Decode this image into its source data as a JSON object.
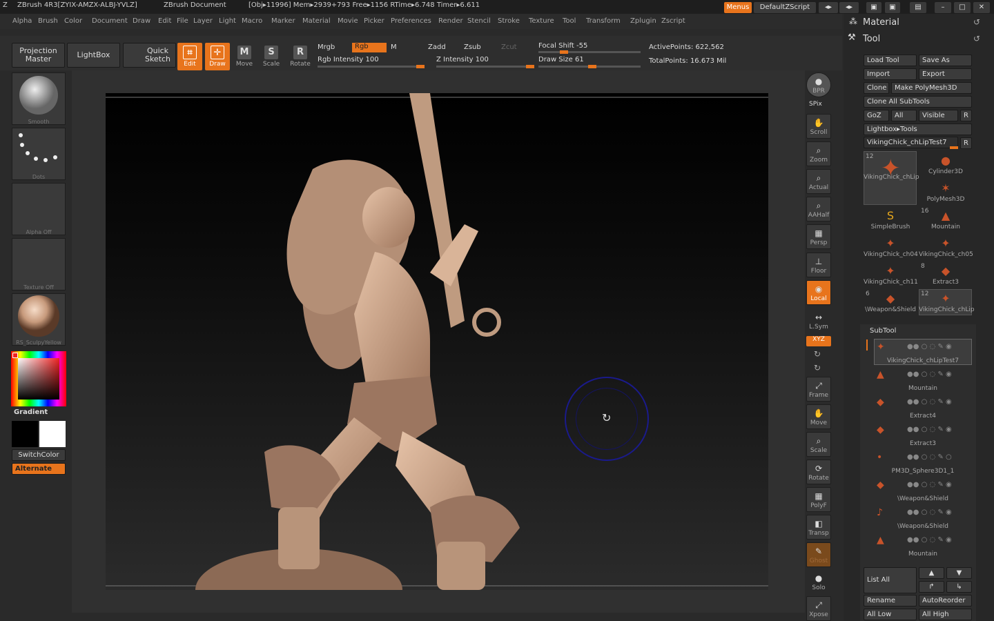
{
  "titlebar": {
    "app_title": "ZBrush 4R3[ZYIX-AMZX-ALBJ-YVLZ]",
    "document": "ZBrush Document",
    "stats": "[Obj▸11996] Mem▸2939+793 Free▸1156 RTime▸6.748 Timer▸6.611",
    "menus_label": "Menus",
    "script_label": "DefaultZScript"
  },
  "menubar": {
    "items": [
      "Alpha",
      "Brush",
      "Color",
      "Document",
      "Draw",
      "Edit",
      "File",
      "Layer",
      "Light",
      "Macro",
      "Marker",
      "Material",
      "Movie",
      "Picker",
      "Preferences",
      "Render",
      "Stencil",
      "Stroke",
      "Texture",
      "Tool",
      "Transform",
      "Zplugin",
      "Zscript"
    ]
  },
  "toolbar": {
    "projection_master": "Projection Master",
    "lightbox": "LightBox",
    "quick_sketch": "Quick Sketch",
    "edit": "Edit",
    "draw": "Draw",
    "move": "Move",
    "scale": "Scale",
    "rotate": "Rotate",
    "mrgb": "Mrgb",
    "rgb": "Rgb",
    "m": "M",
    "rgb_intensity": "Rgb Intensity 100",
    "zadd": "Zadd",
    "zsub": "Zsub",
    "zcut": "Zcut",
    "z_intensity": "Z Intensity 100",
    "focal_shift": "Focal Shift -55",
    "draw_size": "Draw Size 61",
    "active_points": "ActivePoints: 622,562",
    "total_points": "TotalPoints: 16.673 Mil",
    "rgb_intensity_value": 100,
    "z_intensity_value": 100,
    "focal_shift_value": -55,
    "draw_size_value": 61
  },
  "leftshelf": {
    "brush": "Smooth",
    "stroke": "Dots",
    "alpha": "Alpha  Off",
    "texture": "Texture  Off",
    "material": "RS_SculpyYellow",
    "gradient": "Gradient",
    "switch_color": "SwitchColor",
    "alternate": "Alternate"
  },
  "rightshelf": {
    "bpr": "BPR",
    "spix": "SPix",
    "scroll": "Scroll",
    "zoom": "Zoom",
    "actual": "Actual",
    "aahalf": "AAHalf",
    "persp": "Persp",
    "floor": "Floor",
    "local": "Local",
    "lsym": "L.Sym",
    "xyz": "XYZ",
    "frame": "Frame",
    "move": "Move",
    "scale": "Scale",
    "rotate": "Rotate",
    "polyf": "PolyF",
    "transp": "Transp",
    "ghost": "Ghost",
    "solo": "Solo",
    "xpose": "Xpose"
  },
  "palette": {
    "material": "Material",
    "tool": "Tool",
    "load_tool": "Load Tool",
    "save_as": "Save As",
    "import": "Import",
    "export": "Export",
    "clone": "Clone",
    "make_polymesh": "Make PolyMesh3D",
    "clone_all": "Clone  All  SubTools",
    "goz": "GoZ",
    "all": "All",
    "visible": "Visible",
    "r": "R",
    "lightbox_tools": "Lightbox▸Tools",
    "current_tool": "VikingChick_chLipTest7",
    "tools": [
      {
        "name": "VikingChick_chLip",
        "count": "12"
      },
      {
        "name": "Cylinder3D",
        "count": ""
      },
      {
        "name": "",
        "count": ""
      },
      {
        "name": "PolyMesh3D",
        "count": ""
      },
      {
        "name": "SimpleBrush",
        "count": ""
      },
      {
        "name": "Mountain",
        "count": "16"
      },
      {
        "name": "VikingChick_ch04",
        "count": ""
      },
      {
        "name": "VikingChick_ch05",
        "count": ""
      },
      {
        "name": "VikingChick_ch11",
        "count": ""
      },
      {
        "name": "Extract3",
        "count": "8"
      },
      {
        "name": "\\Weapon&Shield",
        "count": "6"
      },
      {
        "name": "VikingChick_chLip",
        "count": "12"
      }
    ],
    "subtool_title": "SubTool",
    "subtools": [
      "VikingChick_chLipTest7",
      "Mountain",
      "Extract4",
      "Extract3",
      "PM3D_Sphere3D1_1",
      "\\Weapon&Shield",
      "\\Weapon&Shield",
      "Mountain"
    ],
    "list_all": "List  All",
    "rename": "Rename",
    "auto_reorder": "AutoReorder",
    "all_low": "All Low",
    "all_high": "All High"
  }
}
